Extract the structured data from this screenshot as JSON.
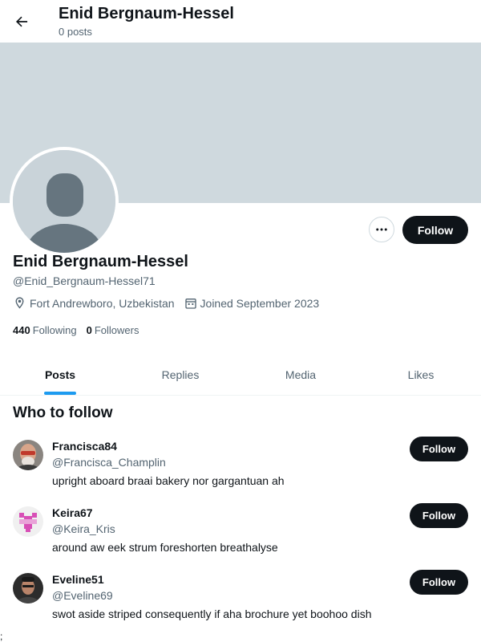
{
  "header": {
    "title": "Enid Bergnaum-Hessel",
    "subtitle": "0 posts"
  },
  "profile": {
    "display_name": "Enid Bergnaum-Hessel",
    "handle": "@Enid_Bergnaum-Hessel71",
    "location": "Fort Andrewboro, Uzbekistan",
    "joined": "Joined September 2023",
    "following_count": "440",
    "following_label": "Following",
    "followers_count": "0",
    "followers_label": "Followers",
    "follow_label": "Follow"
  },
  "tabs": [
    {
      "label": "Posts",
      "active": true
    },
    {
      "label": "Replies"
    },
    {
      "label": "Media"
    },
    {
      "label": "Likes"
    }
  ],
  "who_to_follow": {
    "title": "Who to follow",
    "users": [
      {
        "name": "Francisca84",
        "handle": "@Francisca_Champlin",
        "bio": "upright aboard braai bakery nor gargantuan ah",
        "follow_label": "Follow"
      },
      {
        "name": "Keira67",
        "handle": "@Keira_Kris",
        "bio": "around aw eek strum foreshorten breathalyse",
        "follow_label": "Follow"
      },
      {
        "name": "Eveline51",
        "handle": "@Eveline69",
        "bio": "swot aside striped consequently if aha brochure yet boohoo dish",
        "follow_label": "Follow"
      }
    ]
  },
  "stray_char": ";",
  "colors": {
    "accent": "#1d9bf0",
    "button": "#0f1419",
    "banner": "#cfd9de",
    "muted": "#536471"
  }
}
